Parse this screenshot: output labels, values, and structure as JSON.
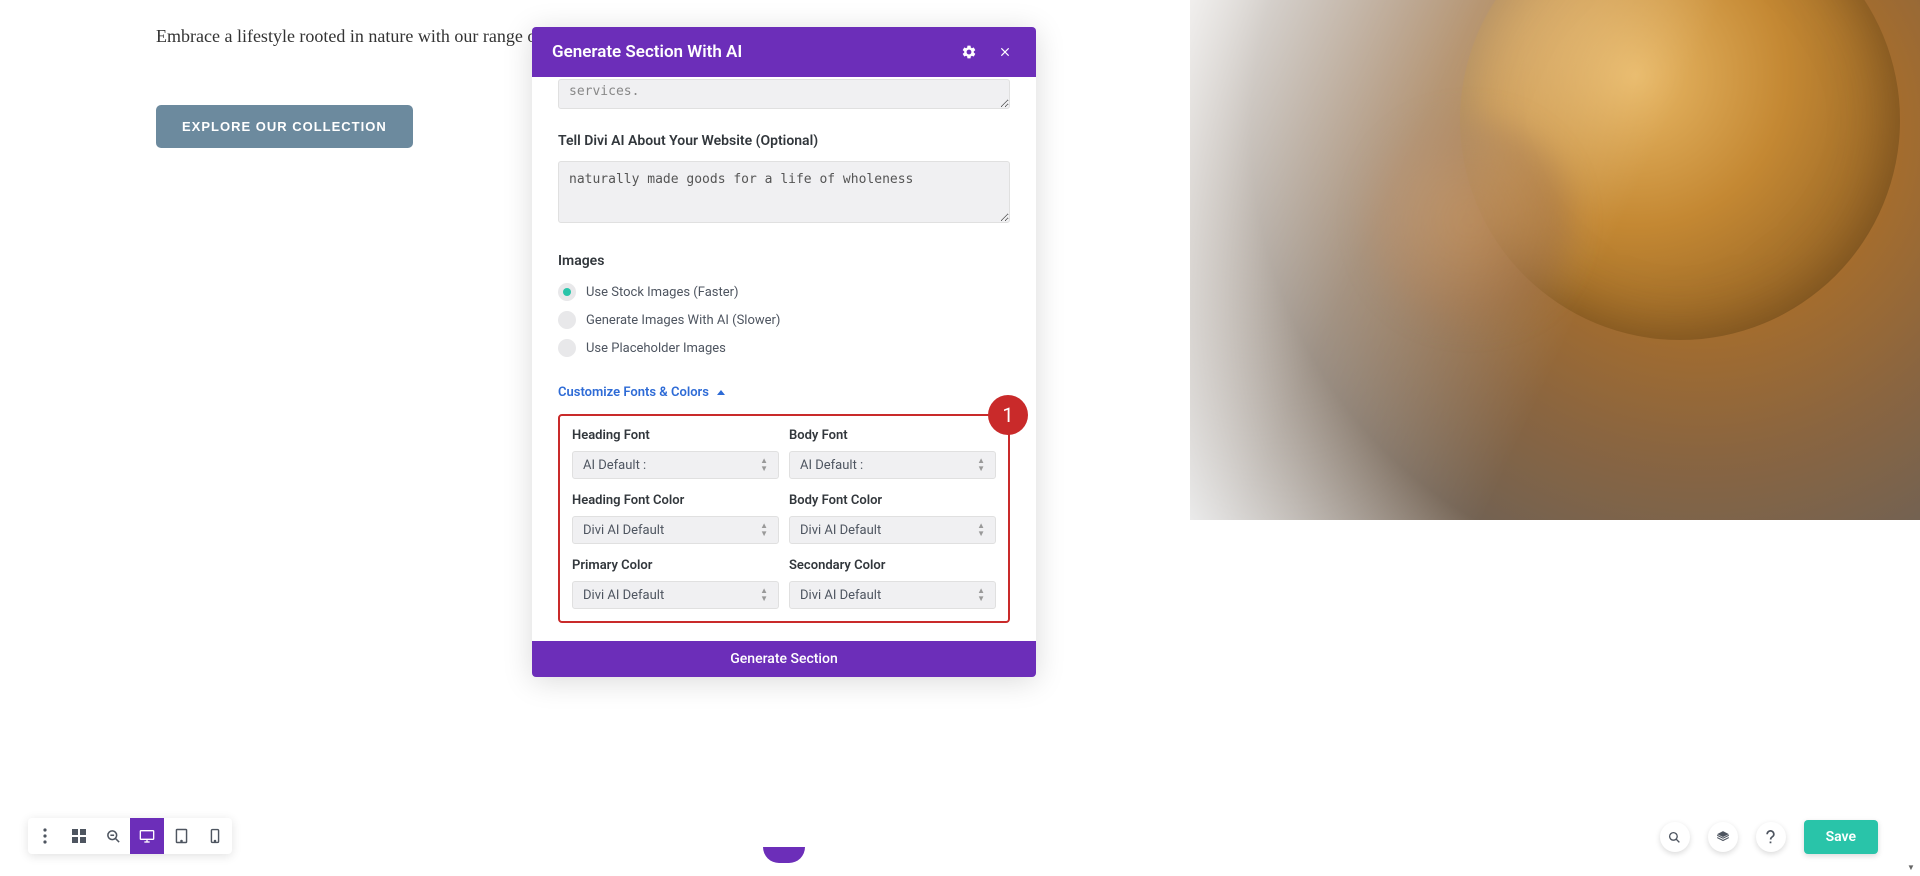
{
  "hero": {
    "text": "Embrace a lifestyle rooted in nature with our range of ... with care and dedication to purity.",
    "cta": "EXPLORE OUR COLLECTION"
  },
  "modal": {
    "title": "Generate Section With AI",
    "services_value": "services.",
    "website_label": "Tell Divi AI About Your Website (Optional)",
    "website_value": "naturally made goods for a life of wholeness",
    "images_label": "Images",
    "radio_options": {
      "stock": "Use Stock Images (Faster)",
      "ai": "Generate Images With AI (Slower)",
      "placeholder": "Use Placeholder Images"
    },
    "customize_link": "Customize Fonts & Colors",
    "badge": "1",
    "fields": {
      "heading_font": {
        "label": "Heading Font",
        "value": "AI Default :"
      },
      "body_font": {
        "label": "Body Font",
        "value": "AI Default :"
      },
      "heading_font_color": {
        "label": "Heading Font Color",
        "value": "Divi AI Default"
      },
      "body_font_color": {
        "label": "Body Font Color",
        "value": "Divi AI Default"
      },
      "primary_color": {
        "label": "Primary Color",
        "value": "Divi AI Default"
      },
      "secondary_color": {
        "label": "Secondary Color",
        "value": "Divi AI Default"
      }
    },
    "footer_button": "Generate Section"
  },
  "toolbar": {
    "save": "Save"
  }
}
